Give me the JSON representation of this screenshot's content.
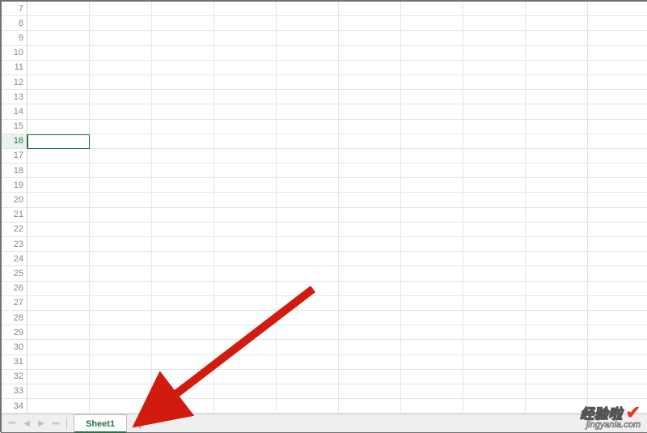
{
  "grid": {
    "first_row": 7,
    "last_row": 34,
    "columns": 10,
    "selected_row": 16,
    "selected_col": 0
  },
  "tabbar": {
    "nav_first": "⏮",
    "nav_prev": "◀",
    "nav_next": "▶",
    "nav_last": "⏭",
    "sheet_label": "Sheet1",
    "add_label": "＋"
  },
  "annotation": {
    "arrow_color": "#d11b0f"
  },
  "watermark": {
    "line1": "经验啦",
    "check": "✔",
    "line2": "jingyanla.com"
  }
}
